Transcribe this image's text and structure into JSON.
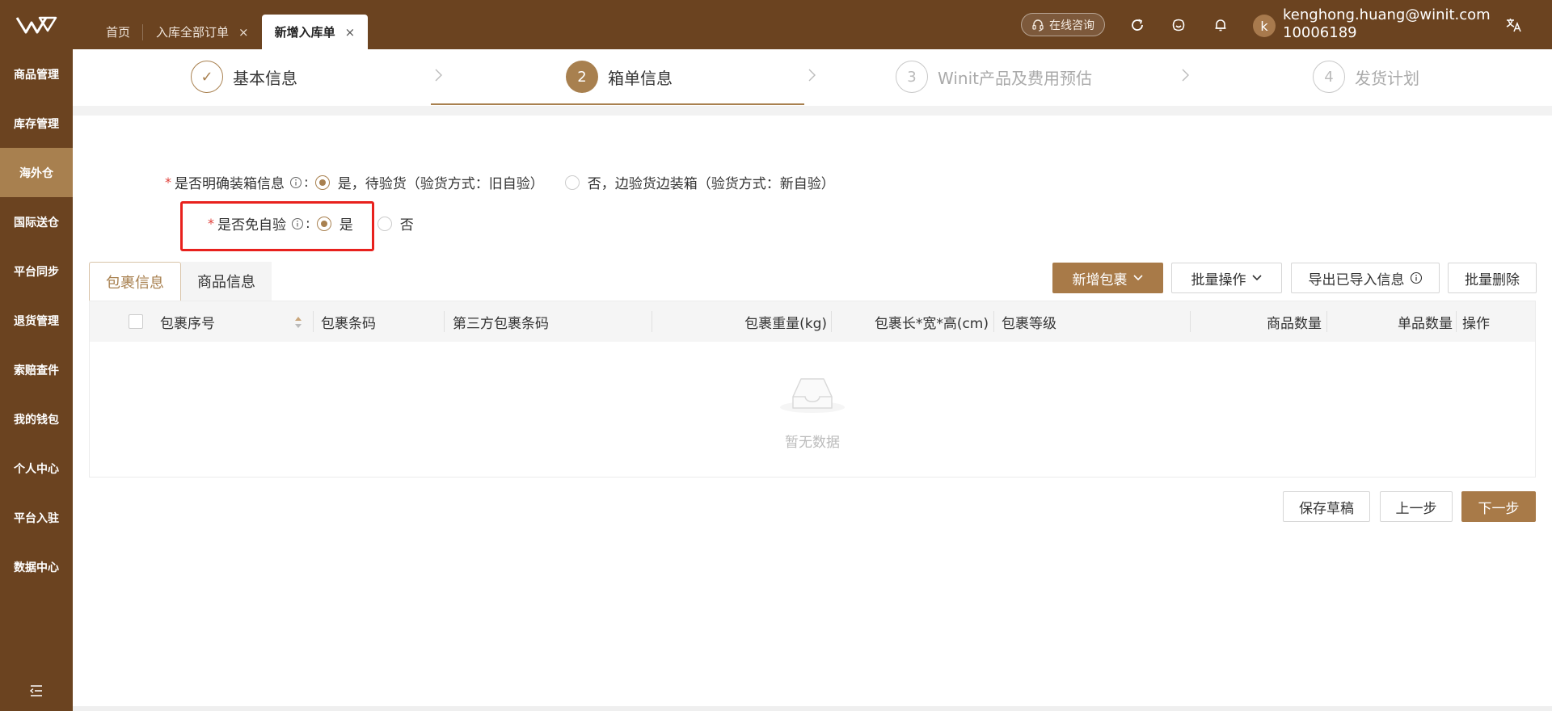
{
  "header": {
    "tabs": [
      {
        "label": "首页",
        "closable": false
      },
      {
        "label": "入库全部订单",
        "closable": true
      },
      {
        "label": "新增入库单",
        "closable": true,
        "active": true
      }
    ],
    "close_glyph": "×",
    "consult_label": "在线咨询",
    "avatar_letter": "k",
    "user_email": "kenghong.huang@winit.com",
    "user_id": "10006189",
    "icons": [
      "refresh-icon",
      "face-icon",
      "bell-icon",
      "translate-icon"
    ]
  },
  "sidebar": {
    "items": [
      {
        "label": "商品管理"
      },
      {
        "label": "库存管理"
      },
      {
        "label": "海外仓",
        "active": true
      },
      {
        "label": "国际送仓"
      },
      {
        "label": "平台同步"
      },
      {
        "label": "退货管理"
      },
      {
        "label": "索赔查件"
      },
      {
        "label": "我的钱包"
      },
      {
        "label": "个人中心"
      },
      {
        "label": "平台入驻"
      },
      {
        "label": "数据中心"
      }
    ]
  },
  "steps": [
    {
      "number": "✓",
      "label": "基本信息",
      "state": "done"
    },
    {
      "number": "2",
      "label": "箱单信息",
      "state": "current"
    },
    {
      "number": "3",
      "label": "Winit产品及费用预估",
      "state": "pending"
    },
    {
      "number": "4",
      "label": "发货计划",
      "state": "pending"
    }
  ],
  "form": {
    "packing_info": {
      "required_mark": "*",
      "label": "是否明确装箱信息",
      "colon": ":",
      "option_yes": "是，待验货（验货方式：旧自验）",
      "option_no": "否，边验货边装箱（验货方式：新自验）",
      "selected": "yes"
    },
    "exempt_inspection": {
      "required_mark": "*",
      "label": "是否免自验",
      "colon": ":",
      "option_yes": "是",
      "option_no": "否",
      "selected": "yes"
    }
  },
  "content_tabs": [
    {
      "label": "包裹信息",
      "active": true
    },
    {
      "label": "商品信息"
    }
  ],
  "actions": {
    "add_package": "新增包裹",
    "batch_ops": "批量操作",
    "export_imported": "导出已导入信息",
    "batch_delete": "批量删除"
  },
  "table": {
    "columns": [
      "包裹序号",
      "包裹条码",
      "第三方包裹条码",
      "包裹重量(kg)",
      "包裹长*宽*高(cm)",
      "包裹等级",
      "商品数量",
      "单品数量",
      "操作"
    ],
    "empty_text": "暂无数据"
  },
  "footer": {
    "save_draft": "保存草稿",
    "prev": "上一步",
    "next": "下一步"
  },
  "colors": {
    "brand_brown": "#6b4320",
    "accent": "#a8804f",
    "highlight_red": "#e8211d"
  }
}
